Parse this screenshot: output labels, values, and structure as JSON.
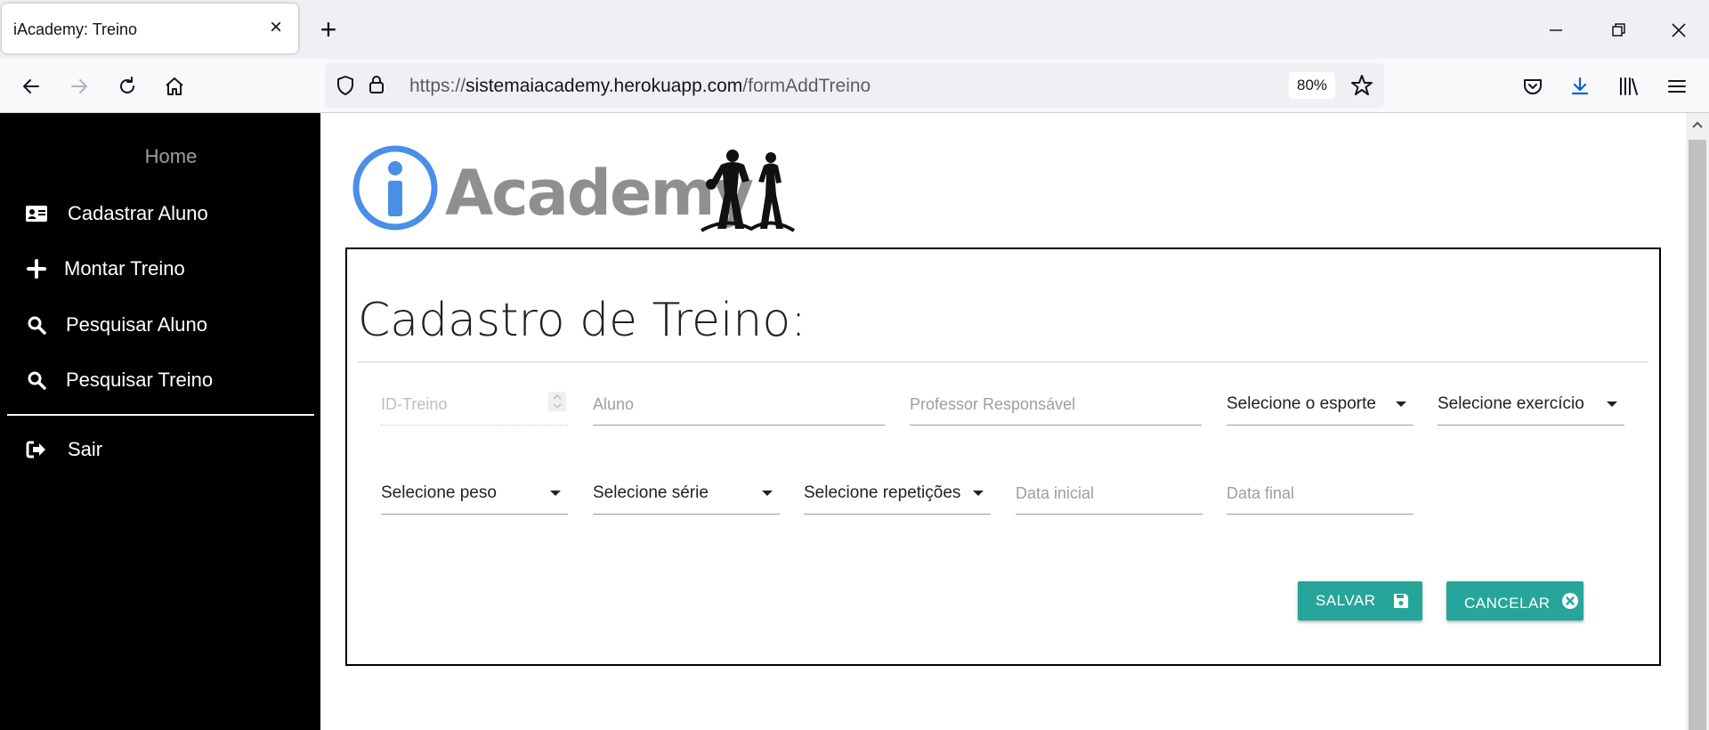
{
  "browser": {
    "tab_title": "iAcademy: Treino",
    "url_scheme": "https://",
    "url_host": "sistemaiacademy.herokuapp.com",
    "url_path": "/formAddTreino",
    "zoom": "80%"
  },
  "sidebar": {
    "home": "Home",
    "items": [
      {
        "label": "Cadastrar Aluno",
        "icon": "id-card-icon"
      },
      {
        "label": "Montar Treino",
        "icon": "plus-icon"
      },
      {
        "label": "Pesquisar Aluno",
        "icon": "search-icon"
      },
      {
        "label": "Pesquisar Treino",
        "icon": "search-icon"
      }
    ],
    "logout": {
      "label": "Sair",
      "icon": "sign-out-icon"
    }
  },
  "logo": {
    "text": "Academy",
    "accent": "#4a8fe7"
  },
  "form": {
    "title": "Cadastro de Treino:",
    "row1": {
      "id_placeholder": "ID-Treino",
      "aluno_placeholder": "Aluno",
      "professor_placeholder": "Professor Responsável",
      "esporte_selected": "Selecione o esporte",
      "exercicio_selected": "Selecione exercício"
    },
    "row2": {
      "peso_selected": "Selecione peso",
      "serie_selected": "Selecione série",
      "repeticoes_selected": "Selecione repetições",
      "data_inicial_placeholder": "Data inicial",
      "data_final_placeholder": "Data final"
    },
    "buttons": {
      "save": "SALVAR",
      "cancel": "CANCELAR"
    }
  },
  "colors": {
    "button": "#26a69a",
    "sidebar_bg": "#000000",
    "logo_gray": "#8f8f8f"
  }
}
